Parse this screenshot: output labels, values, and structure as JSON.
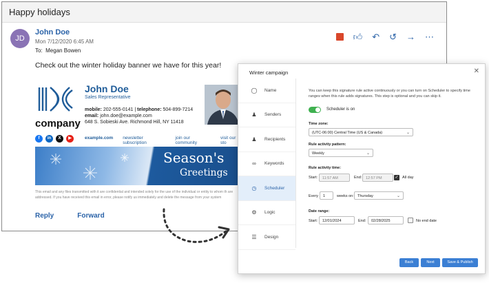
{
  "email": {
    "subject": "Happy holidays",
    "avatar_initials": "JD",
    "sender": "John Doe",
    "date": "Mon 7/12/2020 6:45 AM",
    "to_label": "To:",
    "to_name": "Megan Bowen",
    "body": "Check out the winter holiday banner we have for this year!",
    "signature": {
      "name": "John Doe",
      "title": "Sales Representative",
      "mobile_label": "mobile:",
      "mobile": "202-555-0141",
      "telephone_label": "telephone:",
      "telephone": "504-899-7214",
      "email_label": "email:",
      "email": "john.doe@example.com",
      "address": "648 S. Sobieski Ave. Richmond Hill, NY 11418",
      "company": "company",
      "links": [
        "example.com",
        "newsletter subscription",
        "join our community",
        "visit our sto"
      ]
    },
    "banner": {
      "line1": "Season's",
      "line2": "Greetings"
    },
    "disclaimer": "This email and any files transmitted with it are confidential and intended solely for the use of the individual or entity to whom th are addressed. If you have received this email in error, please notify us immediately and delete the message from your system",
    "reply": "Reply",
    "forward": "Forward"
  },
  "dialog": {
    "title": "Winter campaign",
    "nav": [
      "Name",
      "Senders",
      "Recipients",
      "Keywords",
      "Scheduler",
      "Logic",
      "Design"
    ],
    "active_nav": "Scheduler",
    "description": "You can keep this signature rule active continuously or you can turn on Scheduler to specify time ranges when this rule adds signatures. This step is optional and you can skip it.",
    "toggle_label": "Scheduler is on",
    "timezone_label": "Time zone:",
    "timezone_value": "(UTC-06:00) Central Time (US & Canada)",
    "pattern_label": "Rule activity pattern:",
    "pattern_value": "Weekly",
    "time_label": "Rule activity time:",
    "start_label": "Start:",
    "start_time": "11:57 AM",
    "end_label": "End:",
    "end_time": "12:57 PM",
    "all_day": "All day",
    "every_label": "Every",
    "every_value": "1",
    "weeks_on": "weeks on:",
    "weekday": "Thursday",
    "range_label": "Date range:",
    "range_start_label": "Start:",
    "range_start": "12/01/2024",
    "range_end_label": "End:",
    "range_end": "02/28/2025",
    "no_end": "No end date",
    "back": "Back",
    "next": "Next",
    "save": "Save & Publish"
  }
}
